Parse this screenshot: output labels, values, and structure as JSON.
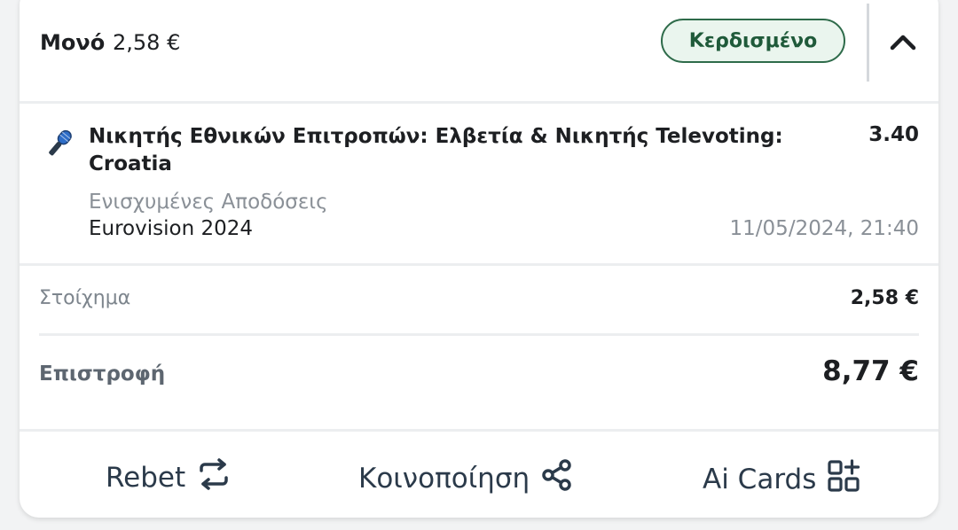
{
  "header": {
    "bet_type": "Μονό",
    "amount": "2,58 €",
    "status": "Κερδισμένο"
  },
  "selection": {
    "title": "Νικητής Εθνικών Επιτροπών: Ελβετία & Νικητής Televoting: Croatia",
    "odds": "3.40",
    "market": "Ενισχυμένες Αποδόσεις",
    "event": "Eurovision 2024",
    "date": "11/05/2024, 21:40",
    "icon": "microphone-icon"
  },
  "stake": {
    "label": "Στοίχημα",
    "value": "2,58 €"
  },
  "return": {
    "label": "Επιστροφή",
    "value": "8,77 €"
  },
  "actions": {
    "rebet": "Rebet",
    "share": "Κοινοποίηση",
    "ai_cards": "Ai Cards"
  },
  "colors": {
    "status_border": "#2e6b4a",
    "status_bg": "#eaf5ee",
    "status_text": "#1f5a3a",
    "action_text": "#2b3a4a"
  }
}
